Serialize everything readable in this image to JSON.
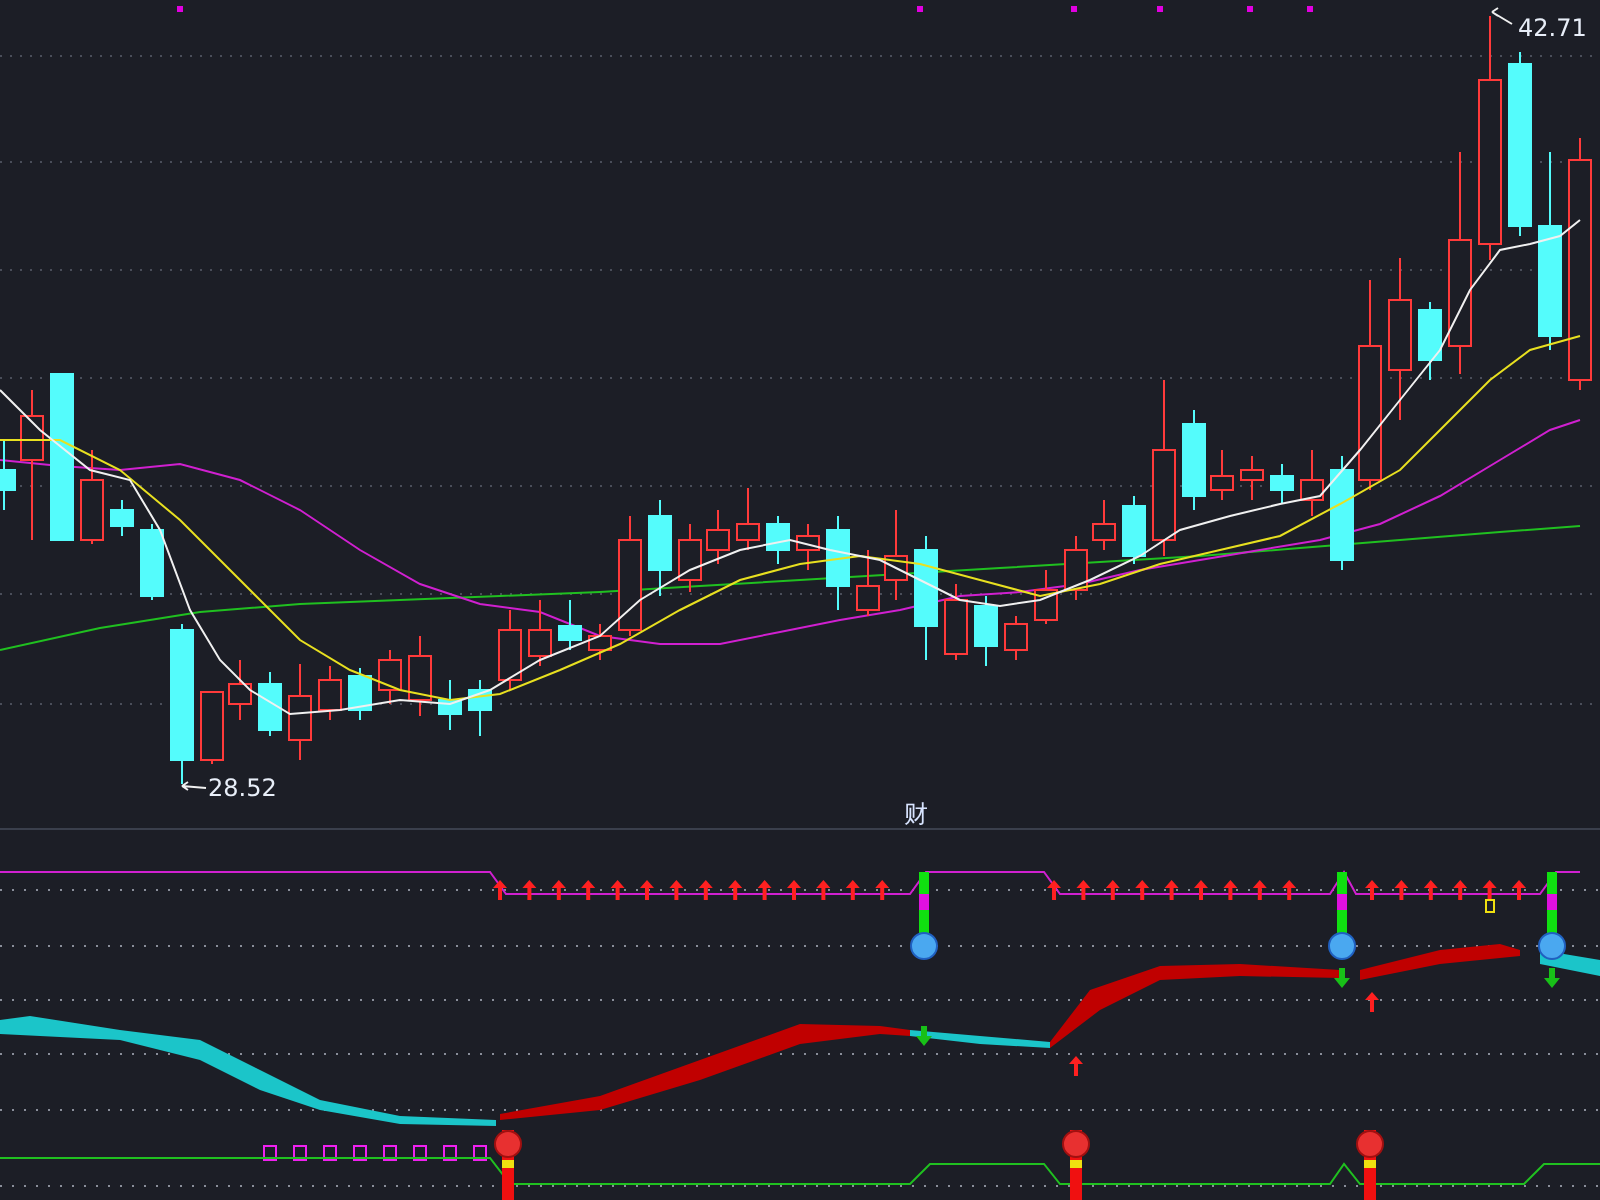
{
  "price_chart": {
    "high_label": "42.71",
    "low_label": "28.52"
  },
  "indicator_panel": {
    "title": "财"
  }
}
